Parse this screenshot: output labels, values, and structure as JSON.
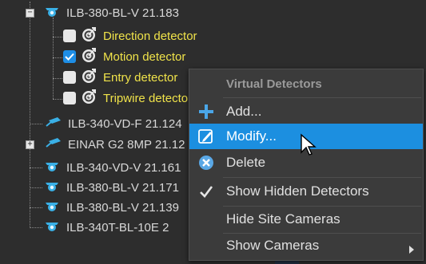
{
  "tree": {
    "items": [
      {
        "label": "ILB-380-BL-V 21.183",
        "icon": "dome-camera-icon",
        "expander": "−"
      },
      {
        "label": "Direction detector",
        "icon": "detector-target-icon"
      },
      {
        "label": "Motion detector",
        "icon": "detector-target-icon",
        "checked": true
      },
      {
        "label": "Entry detector",
        "icon": "detector-target-icon"
      },
      {
        "label": "Tripwire detector",
        "icon": "detector-target-icon"
      },
      {
        "label": "ILB-340-VD-F 21.124",
        "icon": "bullet-camera-icon"
      },
      {
        "label": "EINAR G2 8MP 21.12",
        "icon": "bullet-camera-icon",
        "expander": "+"
      },
      {
        "label": "ILB-340-VD-V 21.161",
        "icon": "dome-camera-icon"
      },
      {
        "label": "ILB-380-BL-V 21.171",
        "icon": "dome-camera-icon"
      },
      {
        "label": "ILB-380-BL-V 21.139",
        "icon": "dome-camera-icon"
      },
      {
        "label": "ILB-340T-BL-10E 2",
        "icon": "dome-camera-icon"
      }
    ]
  },
  "context_menu": {
    "header": "Virtual Detectors",
    "items": [
      {
        "label": "Add...",
        "icon": "plus-icon"
      },
      {
        "label": "Modify...",
        "icon": "edit-icon",
        "highlighted": true
      },
      {
        "label": "Delete",
        "icon": "delete-circle-icon"
      },
      {
        "label": "Show Hidden Detectors",
        "icon": "checkmark-icon"
      },
      {
        "label": "Hide Site Cameras",
        "icon": ""
      },
      {
        "label": "Show Cameras",
        "icon": "submenu-arrow-icon"
      }
    ]
  },
  "colors": {
    "background": "#2d2d2d",
    "detector_text": "#f0e34a",
    "highlight": "#1c8fe0",
    "camera_icon": "#3ab0e6"
  }
}
